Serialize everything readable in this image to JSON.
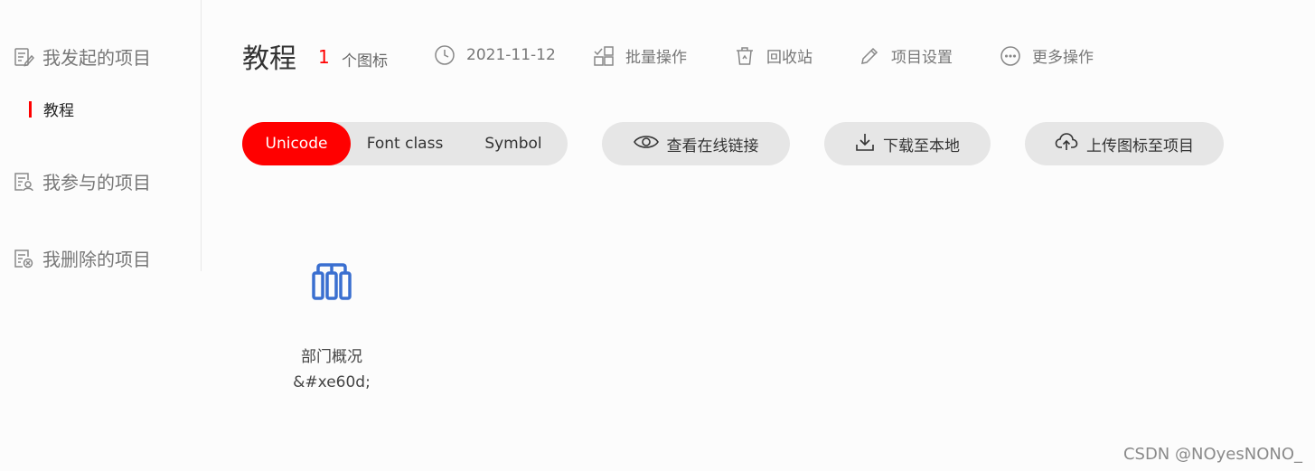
{
  "sidebar": {
    "my_projects": "我发起的项目",
    "current_project": "教程",
    "joined_projects": "我参与的项目",
    "deleted_projects": "我删除的项目"
  },
  "header": {
    "title": "教程",
    "icon_count": "1",
    "count_unit": "个图标",
    "date": "2021-11-12",
    "batch": "批量操作",
    "recycle": "回收站",
    "settings": "项目设置",
    "more": "更多操作"
  },
  "tabs": {
    "unicode": "Unicode",
    "font_class": "Font class",
    "symbol": "Symbol",
    "active": "Unicode"
  },
  "actions": {
    "view_online": "查看在线链接",
    "download": "下载至本地",
    "upload": "上传图标至项目"
  },
  "icons": [
    {
      "name": "部门概况",
      "code": "&#xe60d;",
      "icon": "department-overview-icon",
      "color": "#3a6fd0"
    }
  ],
  "watermark": "CSDN @NOyesNONO_",
  "colors": {
    "accent": "#ff0000",
    "icon_blue": "#3a6fd0",
    "pill_bg": "#e6e6e6"
  }
}
